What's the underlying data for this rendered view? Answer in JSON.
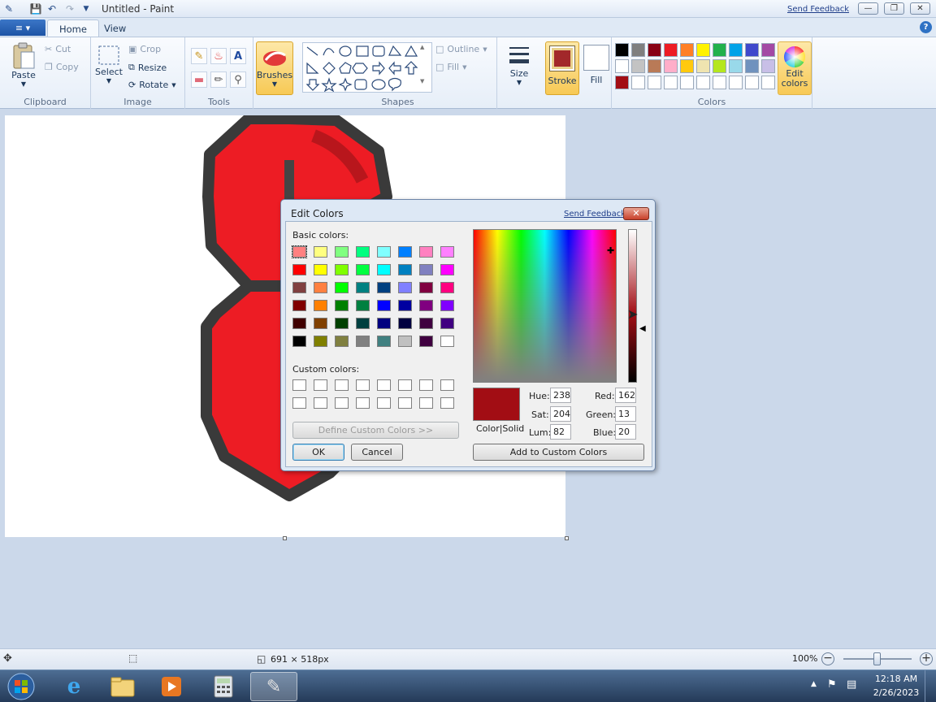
{
  "window": {
    "title": "Untitled - Paint",
    "send_feedback": "Send Feedback"
  },
  "tabs": {
    "file": "≡ ▾",
    "home": "Home",
    "view": "View"
  },
  "ribbon": {
    "clipboard": {
      "label": "Clipboard",
      "paste": "Paste",
      "cut": "Cut",
      "copy": "Copy"
    },
    "image": {
      "label": "Image",
      "select": "Select",
      "crop": "Crop",
      "resize": "Resize",
      "rotate": "Rotate"
    },
    "tools": {
      "label": "Tools"
    },
    "brushes": {
      "label": "Brushes"
    },
    "shapes": {
      "label": "Shapes",
      "outline": "Outline",
      "fill": "Fill"
    },
    "size": {
      "label": "Size"
    },
    "stroke": {
      "label": "Stroke",
      "color": "#a2282a"
    },
    "fill_btn": {
      "label": "Fill"
    },
    "colors": {
      "label": "Colors",
      "edit_colors": "Edit colors",
      "palette": [
        "#000000",
        "#7f7f7f",
        "#880015",
        "#ed1c24",
        "#ff7f27",
        "#fff200",
        "#22b14c",
        "#00a2e8",
        "#3f48cc",
        "#a349a4",
        "#ffffff",
        "#c3c3c3",
        "#b97a57",
        "#ffaec9",
        "#ffc90e",
        "#efe4b0",
        "#b5e61d",
        "#99d9ea",
        "#7092be",
        "#c8bfe7",
        "#a20d14",
        "#ffffff",
        "#ffffff",
        "#ffffff",
        "#ffffff",
        "#ffffff",
        "#ffffff",
        "#ffffff",
        "#ffffff",
        "#ffffff"
      ]
    }
  },
  "dialog": {
    "title": "Edit Colors",
    "send_feedback": "Send Feedback",
    "basic_label": "Basic colors:",
    "basic_colors": [
      "#ff8080",
      "#ffff80",
      "#80ff80",
      "#00ff80",
      "#80ffff",
      "#0080ff",
      "#ff80c0",
      "#ff80ff",
      "#ff0000",
      "#ffff00",
      "#80ff00",
      "#00ff40",
      "#00ffff",
      "#0080c0",
      "#8080c0",
      "#ff00ff",
      "#804040",
      "#ff8040",
      "#00ff00",
      "#008080",
      "#004080",
      "#8080ff",
      "#800040",
      "#ff0080",
      "#800000",
      "#ff8000",
      "#008000",
      "#008040",
      "#0000ff",
      "#0000a0",
      "#800080",
      "#8000ff",
      "#400000",
      "#804000",
      "#004000",
      "#004040",
      "#000080",
      "#000040",
      "#400040",
      "#400080",
      "#000000",
      "#808000",
      "#808040",
      "#808080",
      "#408080",
      "#c0c0c0",
      "#400040",
      "#ffffff"
    ],
    "custom_label": "Custom colors:",
    "define_custom": "Define Custom Colors >>",
    "ok": "OK",
    "cancel": "Cancel",
    "color_solid": "Color|Solid",
    "hue_label": "Hue:",
    "hue": "238",
    "sat_label": "Sat:",
    "sat": "204",
    "lum_label": "Lum:",
    "lum": "82",
    "red_label": "Red:",
    "red": "162",
    "green_label": "Green:",
    "green": "13",
    "blue_label": "Blue:",
    "blue": "20",
    "add_custom": "Add to Custom Colors",
    "selected_color": "#a20d14"
  },
  "status": {
    "canvas_size": "691 × 518px",
    "zoom": "100%"
  },
  "taskbar": {
    "time": "12:18 AM",
    "date": "2/26/2023"
  }
}
